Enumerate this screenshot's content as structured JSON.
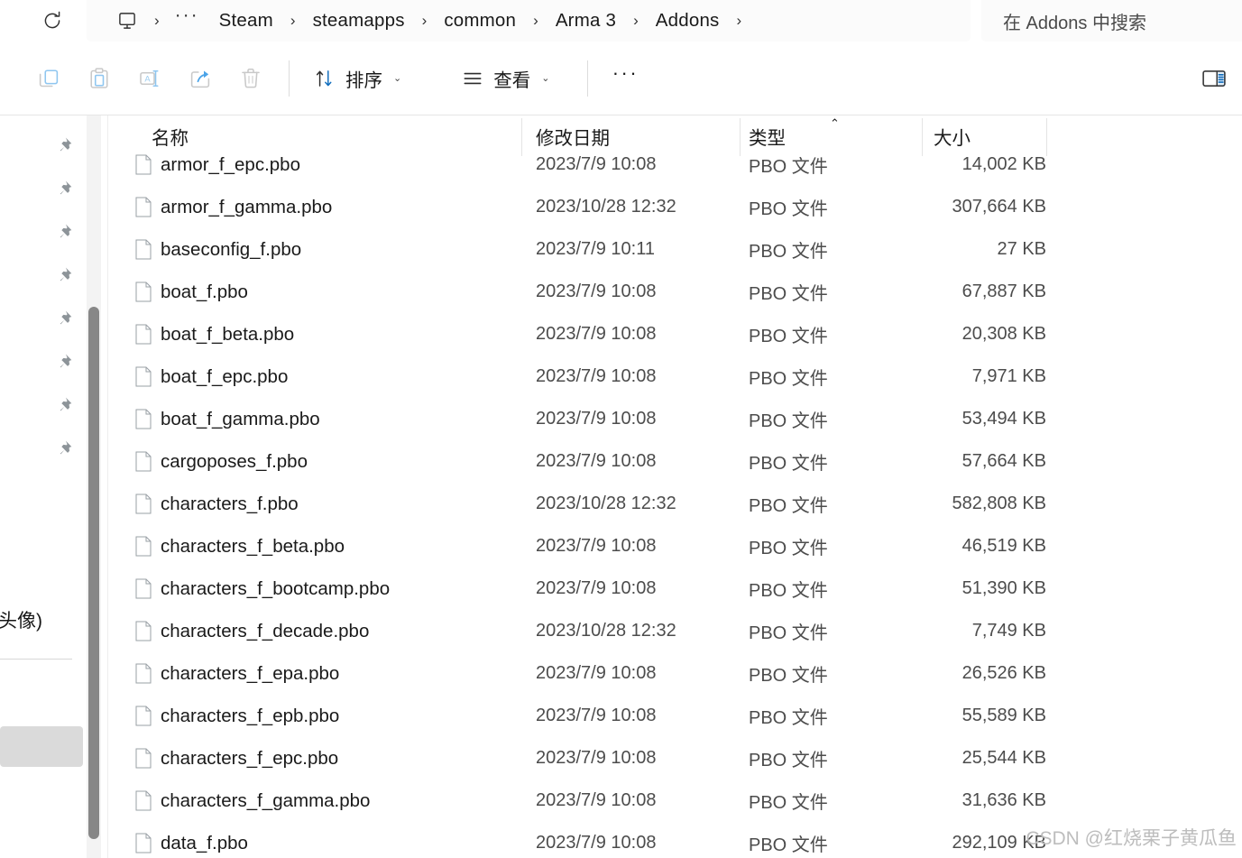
{
  "window": {
    "app": "File Explorer",
    "current_folder": "Addons"
  },
  "address_bar": {
    "refresh_icon": "refresh-icon",
    "pc_icon": "this-pc-monitor-icon",
    "overflow_crumb": "···",
    "separator": "›",
    "crumbs": [
      {
        "label": "Steam"
      },
      {
        "label": "steamapps"
      },
      {
        "label": "common"
      },
      {
        "label": "Arma 3"
      },
      {
        "label": "Addons"
      }
    ]
  },
  "search": {
    "placeholder": "在 Addons 中搜索",
    "value": ""
  },
  "toolbar": {
    "buttons": [
      {
        "name": "copy-button",
        "icon": "copy-icon",
        "enabled": false
      },
      {
        "name": "paste-button",
        "icon": "paste-icon",
        "enabled": false
      },
      {
        "name": "rename-button",
        "icon": "rename-icon",
        "enabled": false
      },
      {
        "name": "share-button",
        "icon": "share-icon",
        "enabled": false
      },
      {
        "name": "delete-button",
        "icon": "trash-icon",
        "enabled": false
      }
    ],
    "sort_label": "排序",
    "view_label": "查看",
    "overflow_label": "···",
    "details_pane_icon": "details-pane-icon",
    "chevron": "⌄"
  },
  "nav_pane": {
    "pin_icon": "pin-icon",
    "pinned_count": 8,
    "partial_text": "头像)"
  },
  "columns": {
    "name": "名称",
    "date_modified": "修改日期",
    "type": "类型",
    "size": "大小",
    "sort_column": "类型",
    "sort_direction": "ascending",
    "sort_caret": "⌃"
  },
  "files": [
    {
      "name": "armor_f_epc.pbo",
      "date": "2023/7/9 10:08",
      "type": "PBO 文件",
      "size": "14,002 KB"
    },
    {
      "name": "armor_f_gamma.pbo",
      "date": "2023/10/28 12:32",
      "type": "PBO 文件",
      "size": "307,664 KB"
    },
    {
      "name": "baseconfig_f.pbo",
      "date": "2023/7/9 10:11",
      "type": "PBO 文件",
      "size": "27 KB"
    },
    {
      "name": "boat_f.pbo",
      "date": "2023/7/9 10:08",
      "type": "PBO 文件",
      "size": "67,887 KB"
    },
    {
      "name": "boat_f_beta.pbo",
      "date": "2023/7/9 10:08",
      "type": "PBO 文件",
      "size": "20,308 KB"
    },
    {
      "name": "boat_f_epc.pbo",
      "date": "2023/7/9 10:08",
      "type": "PBO 文件",
      "size": "7,971 KB"
    },
    {
      "name": "boat_f_gamma.pbo",
      "date": "2023/7/9 10:08",
      "type": "PBO 文件",
      "size": "53,494 KB"
    },
    {
      "name": "cargoposes_f.pbo",
      "date": "2023/7/9 10:08",
      "type": "PBO 文件",
      "size": "57,664 KB"
    },
    {
      "name": "characters_f.pbo",
      "date": "2023/10/28 12:32",
      "type": "PBO 文件",
      "size": "582,808 KB"
    },
    {
      "name": "characters_f_beta.pbo",
      "date": "2023/7/9 10:08",
      "type": "PBO 文件",
      "size": "46,519 KB"
    },
    {
      "name": "characters_f_bootcamp.pbo",
      "date": "2023/7/9 10:08",
      "type": "PBO 文件",
      "size": "51,390 KB"
    },
    {
      "name": "characters_f_decade.pbo",
      "date": "2023/10/28 12:32",
      "type": "PBO 文件",
      "size": "7,749 KB"
    },
    {
      "name": "characters_f_epa.pbo",
      "date": "2023/7/9 10:08",
      "type": "PBO 文件",
      "size": "26,526 KB"
    },
    {
      "name": "characters_f_epb.pbo",
      "date": "2023/7/9 10:08",
      "type": "PBO 文件",
      "size": "55,589 KB"
    },
    {
      "name": "characters_f_epc.pbo",
      "date": "2023/7/9 10:08",
      "type": "PBO 文件",
      "size": "25,544 KB"
    },
    {
      "name": "characters_f_gamma.pbo",
      "date": "2023/7/9 10:08",
      "type": "PBO 文件",
      "size": "31,636 KB"
    },
    {
      "name": "data_f.pbo",
      "date": "2023/7/9 10:08",
      "type": "PBO 文件",
      "size": "292,109 KB"
    }
  ],
  "watermark": {
    "text": "CSDN @红烧栗子黄瓜鱼"
  },
  "colors": {
    "accent": "#0078d4",
    "text": "#1a1a1a",
    "secondary_text": "#4c4c4c",
    "chrome_bg": "#ffffff",
    "field_bg": "#fbfbfb",
    "selection": "#dadada",
    "scrollbar_thumb": "#878787",
    "watermark": "#bdbdbd"
  }
}
